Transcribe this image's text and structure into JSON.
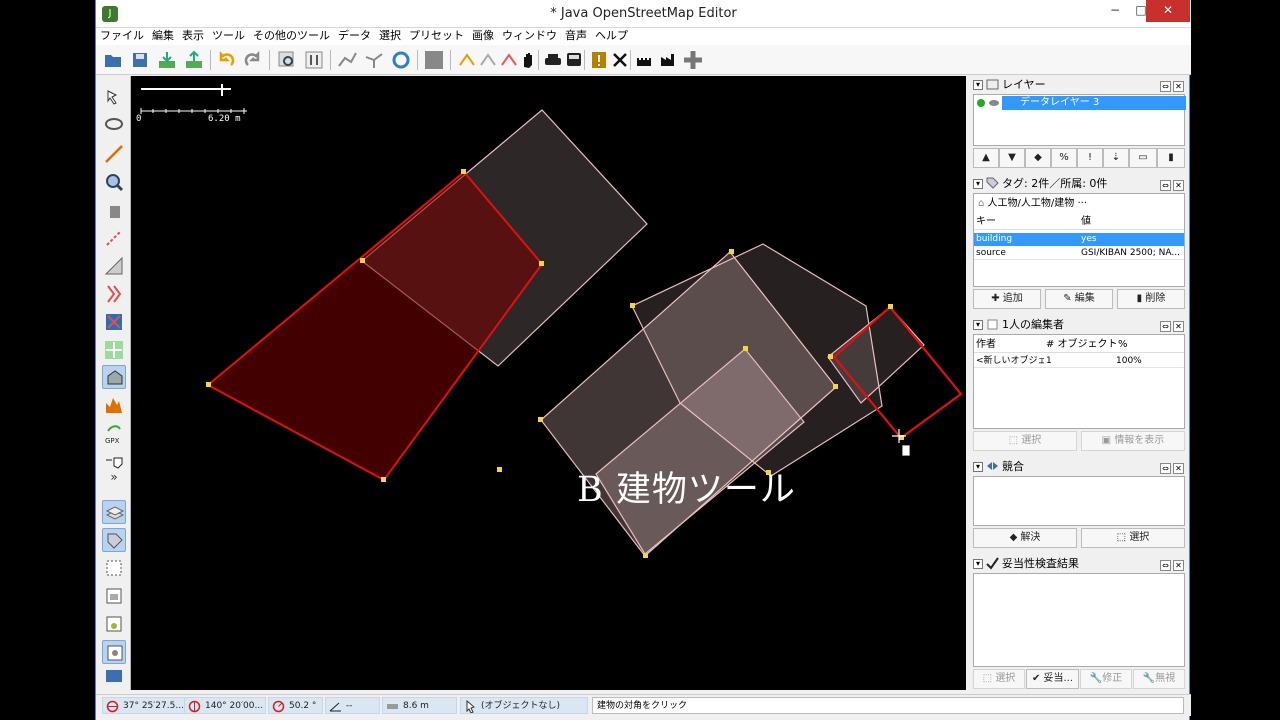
{
  "window": {
    "title": "* Java OpenStreetMap Editor",
    "minimize": "−",
    "maximize": "□",
    "close": "✕"
  },
  "menu": [
    "ファイル",
    "編集",
    "表示",
    "ツール",
    "その他のツール",
    "データ",
    "選択",
    "プリセット",
    "画像",
    "ウィンドウ",
    "音声",
    "ヘルプ"
  ],
  "map": {
    "scale_left": "0",
    "scale_right": "6.20 m",
    "caption": "B 建物ツール"
  },
  "layers": {
    "title": "レイヤー",
    "layer_name": "データレイヤー 3"
  },
  "tags": {
    "title": "タグ: 2件／所属: 0件",
    "preset": "人工物/人工物/建物 ···",
    "col_key": "キー",
    "col_value": "値",
    "rows": [
      {
        "key": "building",
        "value": "yes"
      },
      {
        "key": "source",
        "value": "GSI/KIBAN 2500; NA..."
      }
    ],
    "add": "追加",
    "edit": "編集",
    "delete": "削除"
  },
  "authors": {
    "title": "1人の編集者",
    "col_author": "作者",
    "col_objects": "# オブジェクト",
    "col_percent": "%",
    "rows": [
      {
        "author": "<新しいオブジェ...",
        "objects": "1",
        "percent": "100%"
      }
    ],
    "select": "選択",
    "info": "情報を表示"
  },
  "conflict": {
    "title": "競合",
    "resolve": "解決",
    "select": "選択"
  },
  "validation": {
    "title": "妥当性検査結果",
    "select": "選択",
    "validate": "妥当...",
    "fix": "修正",
    "ignore": "無視"
  },
  "status": {
    "lat": "37° 25′27.5...",
    "lon": "140° 20′00...",
    "heading": "50.2 °",
    "angle": "--",
    "distance": "8.6 m",
    "object": "(オブジェクトなし)",
    "message": "建物の対角をクリック"
  },
  "colors": {
    "selected_outline": "#e01010",
    "building_fill": "#ffd8d8",
    "node": "#f5d442",
    "title_accent": "#3399ff"
  }
}
